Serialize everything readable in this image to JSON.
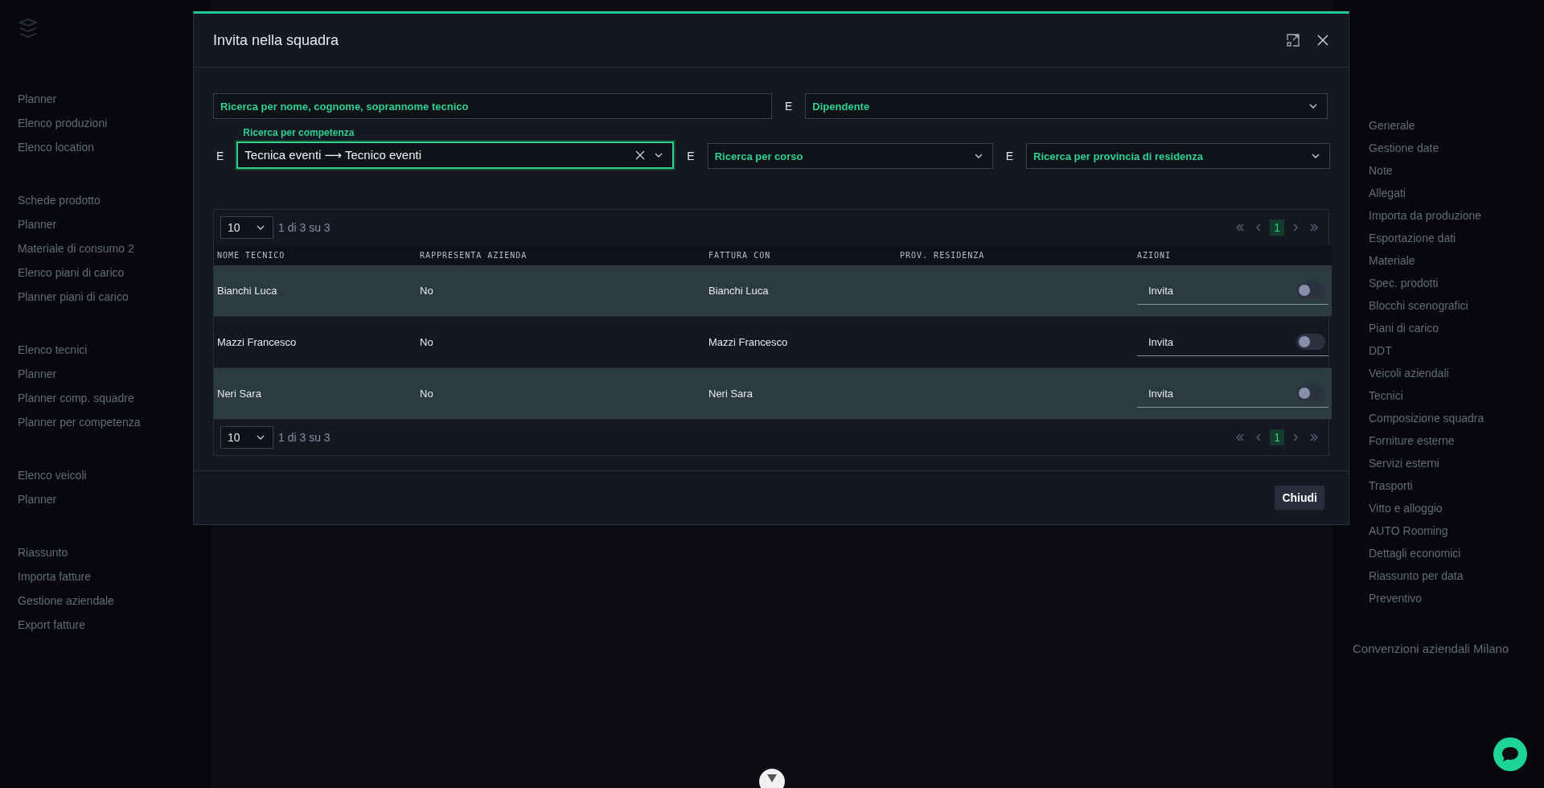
{
  "background": {
    "left_menu": [
      "Planner",
      "Elenco produzioni",
      "Elenco location",
      "Schede prodotto",
      "Planner",
      "Materiale di consumo 2",
      "Elenco piani di carico",
      "Planner piani di carico",
      "Elenco tecnici",
      "Planner",
      "Planner comp. squadre",
      "Planner per competenza",
      "Elenco veicoli",
      "Planner",
      "Riassunto",
      "Importa fatture",
      "Gestione aziendale",
      "Export fatture"
    ],
    "right_menu": [
      "Generale",
      "Gestione date",
      "Note",
      "Allegati",
      "Importa da produzione",
      "Esportazione dati",
      "Materiale",
      "Spec. prodotti",
      "Blocchi scenografici",
      "Piani di carico",
      "DDT",
      "Veicoli aziendali",
      "Tecnici",
      "Composizione squadra",
      "Forniture esterne",
      "Servizi esterni",
      "Trasporti",
      "Vitto e alloggio",
      "AUTO Rooming",
      "Dettagli economici",
      "Riassunto per data",
      "Preventivo"
    ],
    "right_footer": "Convenzioni aziendali Milano"
  },
  "dialog": {
    "title": "Invita nella squadra",
    "filter_rows": [
      [
        {
          "kind": "text",
          "placeholder": "Ricerca per nome, cognome, soprannome tecnico"
        },
        {
          "kind": "select",
          "connector": "E",
          "placeholder": "Dipendente"
        }
      ],
      [
        {
          "kind": "select",
          "connector": "E",
          "label": "Ricerca per competenza",
          "value": "Tecnica eventi ⟶ Tecnico eventi",
          "focused": true
        },
        {
          "kind": "select",
          "connector": "E",
          "placeholder": "Ricerca per corso"
        },
        {
          "kind": "select",
          "connector": "E",
          "placeholder": "Ricerca per provincia di residenza"
        }
      ]
    ],
    "pager_top": {
      "page_size": "10",
      "summary": "1 di 3 su 3",
      "pages": [
        {
          "label": "1",
          "selected": true
        }
      ]
    },
    "columns": [
      "NOME TECNICO",
      "RAPPRESENTA AZIENDA",
      "FATTURA CON",
      "PROV. RESIDENZA",
      "AZIONI"
    ],
    "rows": [
      {
        "name": "Bianchi Luca",
        "represents": "No",
        "invoice_with": "Bianchi Luca",
        "action": {
          "label": "Invita",
          "on": false
        }
      },
      {
        "name": "Mazzi Francesco",
        "represents": "No",
        "invoice_with": "Mazzi Francesco",
        "action": {
          "label": "Invita",
          "on": false
        }
      },
      {
        "name": "Neri Sara",
        "represents": "No",
        "invoice_with": "Neri Sara",
        "action": {
          "label": "Invita",
          "on": false
        }
      }
    ],
    "pager_bottom": {
      "page_size": "10",
      "summary": "1 di 3 su 3",
      "pages": [
        {
          "label": "1",
          "selected": true
        }
      ]
    },
    "buttons": [
      "Chiudi"
    ]
  }
}
